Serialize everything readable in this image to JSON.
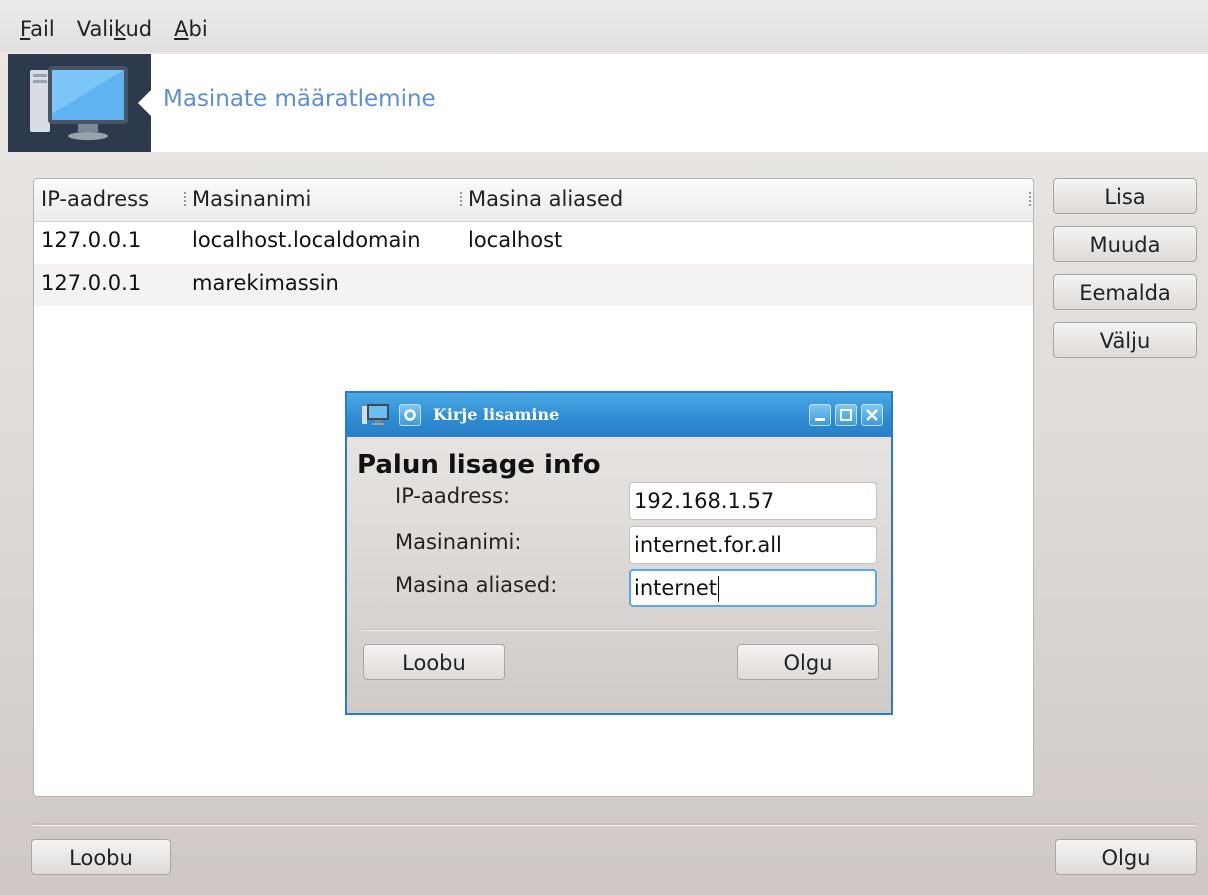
{
  "menubar": {
    "items": [
      {
        "label_underlined": "F",
        "label_rest": "ail"
      },
      {
        "label_pre": "Vali",
        "label_underlined": "k",
        "label_rest": "ud"
      },
      {
        "label_underlined": "A",
        "label_rest": "bi"
      }
    ]
  },
  "header": {
    "title": "Masinate määratlemine",
    "icon": "computer-monitor-icon"
  },
  "table": {
    "columns": [
      "IP-aadress",
      "Masinanimi",
      "Masina aliased"
    ],
    "rows": [
      {
        "ip": "127.0.0.1",
        "name": "localhost.localdomain",
        "alias": "localhost"
      },
      {
        "ip": "127.0.0.1",
        "name": "marekimassin",
        "alias": ""
      }
    ]
  },
  "side_buttons": {
    "add": "Lisa",
    "edit": "Muuda",
    "remove": "Eemalda",
    "quit": "Välju"
  },
  "footer": {
    "cancel": "Loobu",
    "ok": "Olgu"
  },
  "dialog": {
    "title": "Kirje lisamine",
    "heading": "Palun lisage info",
    "fields": {
      "ip_label": "IP-aadress:",
      "ip_value": "192.168.1.57",
      "name_label": "Masinanimi:",
      "name_value": "internet.for.all",
      "alias_label": "Masina aliased:",
      "alias_value": "internet"
    },
    "cancel": "Loobu",
    "ok": "Olgu"
  },
  "colors": {
    "accent_title": "#5a8fd6",
    "dialog_titlebar": "#2e8bd2",
    "banner_dark": "#2d3a4e"
  }
}
